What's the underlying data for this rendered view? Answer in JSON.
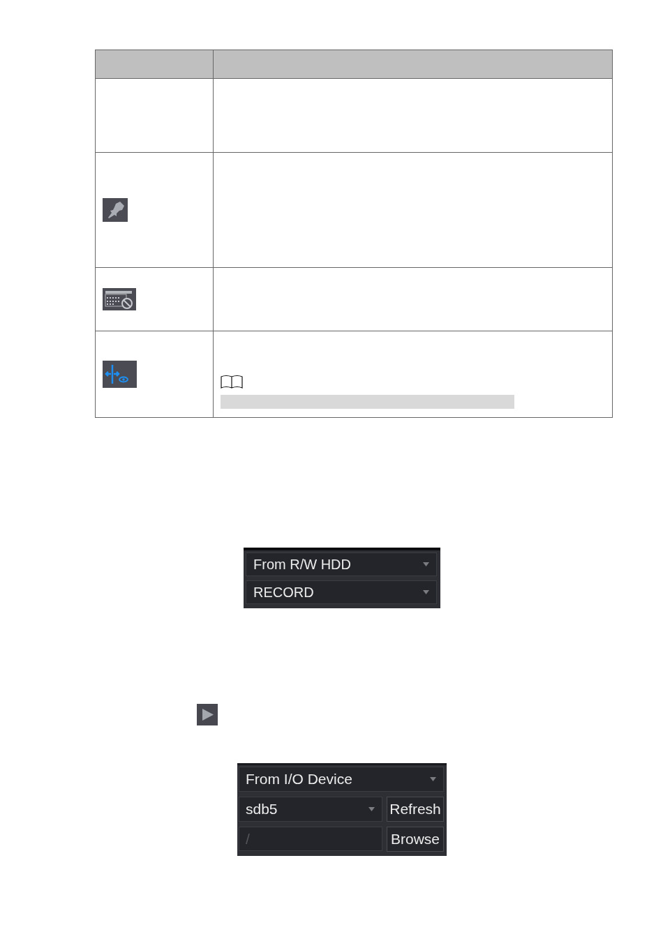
{
  "record_source_panel": {
    "dropdowns": [
      {
        "value": "From R/W HDD"
      },
      {
        "value": "RECORD"
      }
    ]
  },
  "import_panel": {
    "source_dropdown": {
      "value": "From I/O Device"
    },
    "device_dropdown": {
      "value": "sdb5"
    },
    "refresh_button": {
      "label": "Refresh"
    },
    "path_field": {
      "placeholder": "/"
    },
    "browse_button": {
      "label": "Browse"
    }
  }
}
